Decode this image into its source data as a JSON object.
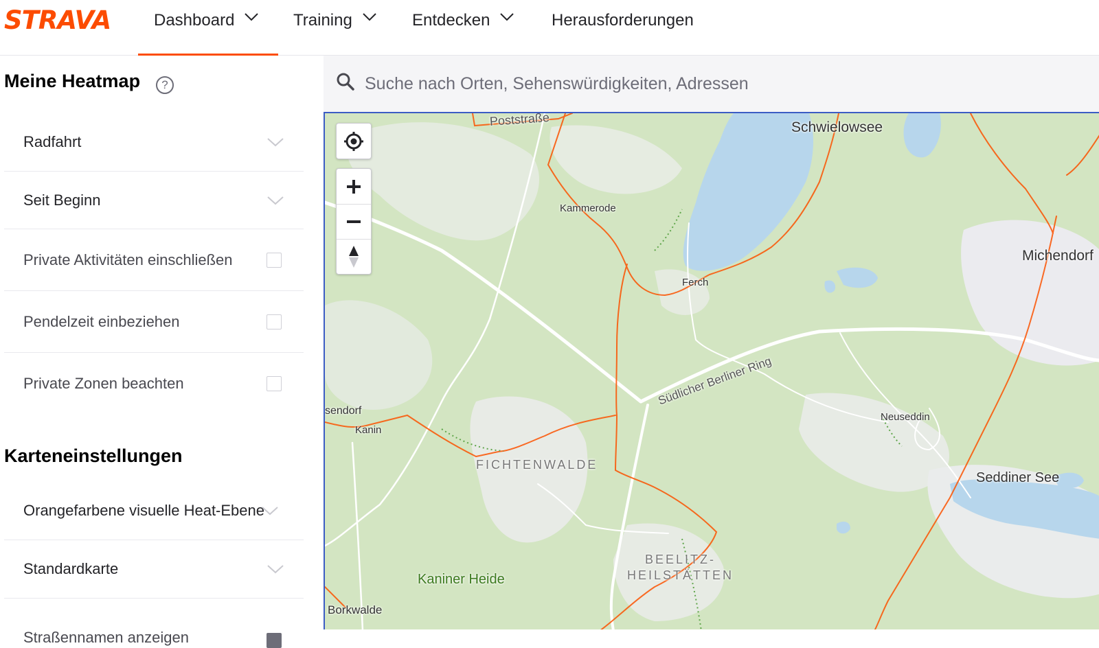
{
  "header": {
    "logo": "STRAVA",
    "nav": [
      {
        "label": "Dashboard"
      },
      {
        "label": "Training"
      },
      {
        "label": "Entdecken"
      },
      {
        "label": "Herausforderungen"
      }
    ]
  },
  "sidebar": {
    "heatmap_title": "Meine Heatmap",
    "help": "?",
    "filters": [
      {
        "label": "Radfahrt"
      },
      {
        "label": "Seit Beginn"
      }
    ],
    "checkboxes": [
      {
        "label": "Private Aktivitäten einschließen",
        "checked": false
      },
      {
        "label": "Pendelzeit einbeziehen",
        "checked": false
      },
      {
        "label": "Private Zonen beachten",
        "checked": false
      }
    ],
    "map_settings_title": "Karteneinstellungen",
    "map_settings": [
      {
        "label": "Orangefarbene visuelle Heat-Ebene"
      },
      {
        "label": "Standardkarte"
      },
      {
        "label": "Straßennamen anzeigen",
        "checked": true
      }
    ]
  },
  "search": {
    "placeholder": "Suche nach Orten, Sehenswürdigkeiten, Adressen"
  },
  "map": {
    "colors": {
      "heat": "#fc5200",
      "forest": "#cfe3bd",
      "water": "#b7d6ec",
      "road": "#ffffff"
    },
    "labels": {
      "poststrasse": "Poststraße",
      "schwielowsee": "Schwielowsee",
      "kammerode": "Kammerode",
      "michendorf": "Michendorf",
      "ferch": "Ferch",
      "berliner_ring": "Südlicher Berliner Ring",
      "sendorf": "sendorf",
      "kanin": "Kanin",
      "neuseddin": "Neuseddin",
      "fichtenwalde": "FICHTENWALDE",
      "seddiner_see": "Seddiner See",
      "beelitz1": "BEELITZ-",
      "beelitz2": "HEILSTÄTTEN",
      "kaniner_heide": "Kaniner Heide",
      "borkwalde": "Borkwalde"
    }
  }
}
